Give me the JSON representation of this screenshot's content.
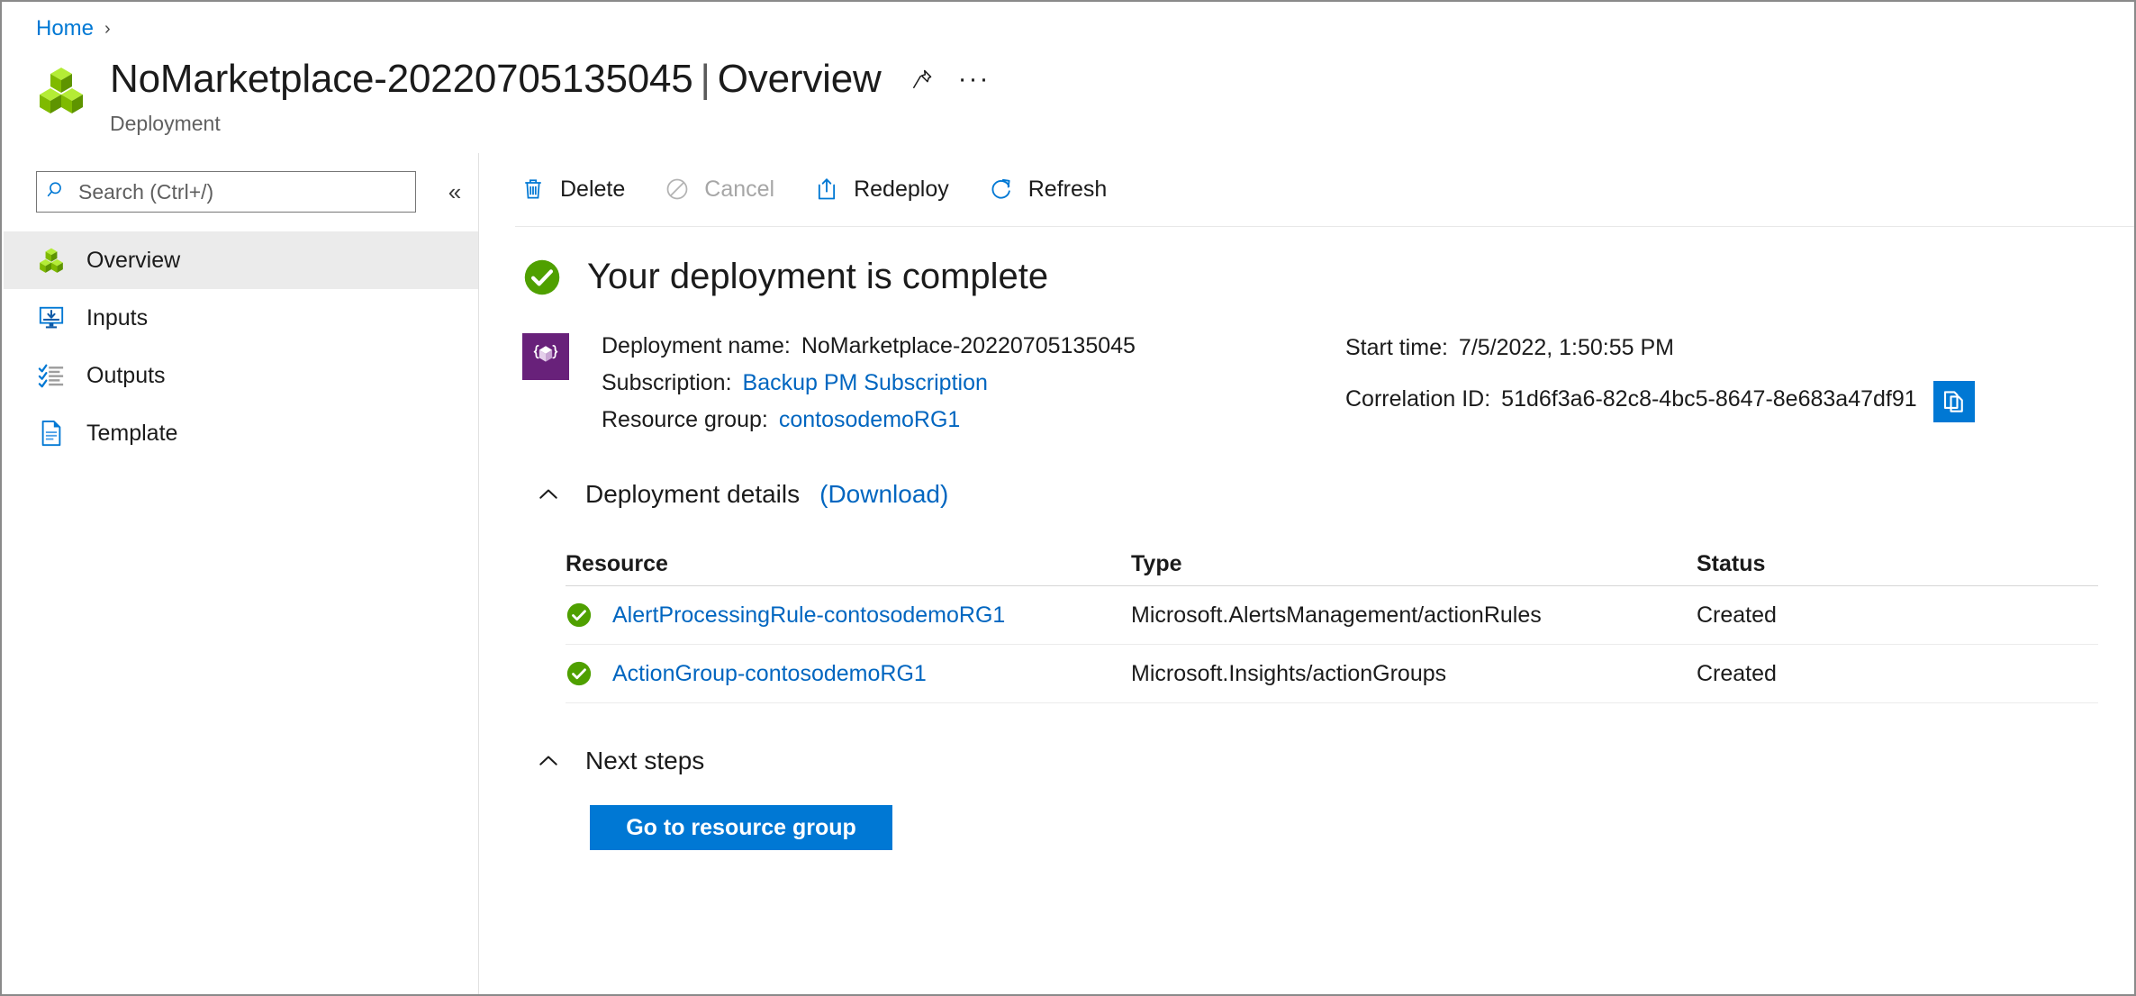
{
  "breadcrumb": {
    "items": [
      "Home"
    ],
    "separator": "›"
  },
  "header": {
    "icon": "deployment-cubes-icon",
    "resource_name": "NoMarketplace-20220705135045",
    "separator": "|",
    "blade_name": "Overview",
    "subtitle": "Deployment",
    "pin_icon": "pin-icon",
    "more_icon": "ellipsis-icon",
    "more_label": "···"
  },
  "search": {
    "placeholder": "Search (Ctrl+/)",
    "value": "",
    "icon": "search-icon",
    "collapse_icon": "double-chevron-left-icon",
    "collapse_label": "«"
  },
  "sidebar": {
    "items": [
      {
        "label": "Overview",
        "icon": "cubes-icon",
        "selected": true
      },
      {
        "label": "Inputs",
        "icon": "inputs-monitor-icon",
        "selected": false
      },
      {
        "label": "Outputs",
        "icon": "outputs-checklist-icon",
        "selected": false
      },
      {
        "label": "Template",
        "icon": "template-document-icon",
        "selected": false
      }
    ]
  },
  "toolbar": {
    "buttons": [
      {
        "label": "Delete",
        "icon": "trash-icon",
        "disabled": false
      },
      {
        "label": "Cancel",
        "icon": "cancel-circle-slash-icon",
        "disabled": true
      },
      {
        "label": "Redeploy",
        "icon": "upload-box-icon",
        "disabled": false
      },
      {
        "label": "Refresh",
        "icon": "refresh-circular-arrow-icon",
        "disabled": false
      }
    ]
  },
  "status": {
    "icon": "green-check-circle-icon",
    "headline": "Your deployment is complete"
  },
  "summary": {
    "icon": "arm-template-icon",
    "left": [
      {
        "label": "Deployment name:",
        "value": "NoMarketplace-20220705135045",
        "is_link": false
      },
      {
        "label": "Subscription:",
        "value": "Backup PM Subscription",
        "is_link": true
      },
      {
        "label": "Resource group:",
        "value": "contosodemoRG1",
        "is_link": true
      }
    ],
    "right": [
      {
        "label": "Start time:",
        "value": "7/5/2022, 1:50:55 PM",
        "is_link": false
      },
      {
        "label": "Correlation ID:",
        "value": "51d6f3a6-82c8-4bc5-8647-8e683a47df91",
        "is_link": false
      }
    ],
    "copy_icon": "copy-to-clipboard-icon"
  },
  "deployment_details": {
    "chevron_icon": "chevron-up-icon",
    "title": "Deployment details",
    "download_link": "(Download)",
    "columns": [
      "Resource",
      "Type",
      "Status"
    ],
    "rows": [
      {
        "status_icon": "green-check-circle-icon",
        "resource": "AlertProcessingRule-contosodemoRG1",
        "type": "Microsoft.AlertsManagement/actionRules",
        "status": "Created"
      },
      {
        "status_icon": "green-check-circle-icon",
        "resource": "ActionGroup-contosodemoRG1",
        "type": "Microsoft.Insights/actionGroups",
        "status": "Created"
      }
    ]
  },
  "next_steps": {
    "chevron_icon": "chevron-up-icon",
    "title": "Next steps",
    "primary_button": "Go to resource group"
  },
  "colors": {
    "accent_blue": "#0078d4",
    "link_blue": "#0066c0",
    "success_green": "#57a300",
    "arm_purple": "#68217a",
    "selected_row": "#ebebeb"
  }
}
